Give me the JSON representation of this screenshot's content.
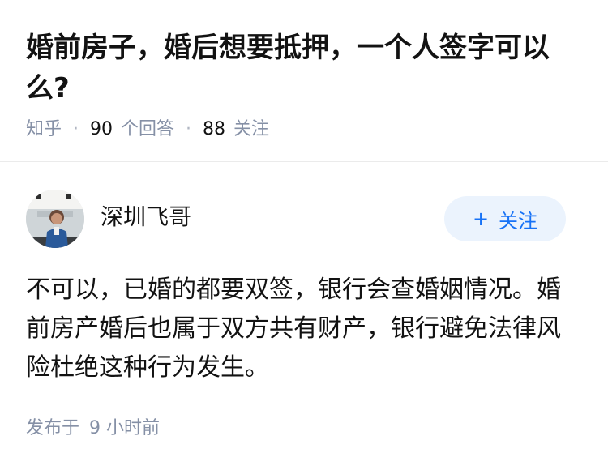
{
  "question": {
    "title": "婚前房子，婚后想要抵押，一个人签字可以么?",
    "source": "知乎",
    "answer_count": "90",
    "answer_unit": "个回答",
    "follower_count": "88",
    "follower_unit": "关注"
  },
  "answer": {
    "author": {
      "name": "深圳飞哥"
    },
    "follow_button": {
      "plus": "+",
      "label": "关注"
    },
    "content": "不可以，已婚的都要双签，银行会查婚姻情况。婚前房产婚后也属于双方共有财产，银行避免法律风险杜绝这种行为发生。",
    "published_prefix": "发布于",
    "published_time": "9 小时前"
  },
  "colors": {
    "accent": "#1772f6",
    "follow_bg": "#ebf3fd",
    "meta_text": "#8590a6",
    "title_text": "#121212"
  },
  "icons": {
    "meta_separator": "dot",
    "follow_plus": "plus-icon"
  }
}
